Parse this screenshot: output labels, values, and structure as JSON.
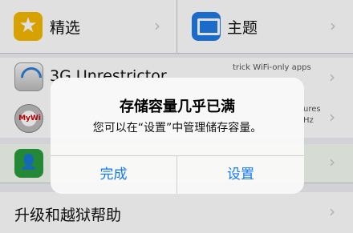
{
  "background": {
    "featured_label": "精选",
    "themes_label": "主题",
    "app1_title": "3G Unrestrictor",
    "app1_desc_line1": "trick WiFi-only apps",
    "app1_desc_line2": "",
    "app2_desc_line1": "ures",
    "app2_desc_line2": "Hz",
    "upgrade_help_label": "升级和越狱帮助"
  },
  "alert": {
    "title": "存储容量几乎已满",
    "message": "您可以在“设置”中管理储存容量。",
    "left_button": "完成",
    "right_button": "设置"
  },
  "colors": {
    "accent": "#1478f2",
    "star_icon": "#f5b800",
    "themes_icon": "#1f7ae8",
    "contact_icon": "#2a9b3f"
  },
  "icons": [
    "star-icon",
    "monitor-icon",
    "wifi-app-icon",
    "mywi-app-icon",
    "contact-app-icon",
    "chevron-right-icon"
  ]
}
